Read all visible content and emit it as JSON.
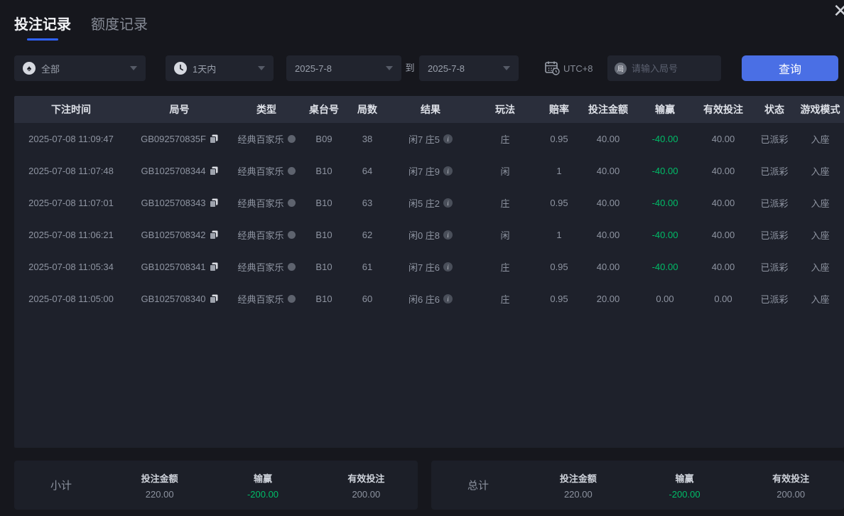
{
  "window": {
    "close_glyph": "✕"
  },
  "tabs": [
    {
      "label": "投注记录",
      "active": true
    },
    {
      "label": "额度记录",
      "active": false
    }
  ],
  "filters": {
    "game_type": {
      "value": "全部",
      "icon": "spade",
      "glyph": "♠"
    },
    "time_range": {
      "value": "1天内",
      "icon": "clock"
    },
    "date_from": "2025-7-8",
    "to_label": "到",
    "date_to": "2025-7-8",
    "timezone": "UTC+8",
    "round_icon_glyph": "局",
    "round_placeholder": "请输入局号",
    "search_label": "查询"
  },
  "table": {
    "headers": [
      "下注时间",
      "局号",
      "类型",
      "桌台号",
      "局数",
      "结果",
      "玩法",
      "赔率",
      "投注金额",
      "输赢",
      "有效投注",
      "状态",
      "游戏模式"
    ],
    "rows": [
      {
        "time": "2025-07-08 11:09:47",
        "round_id": "GB092570835F",
        "type": "经典百家乐",
        "table_no": "B09",
        "round": "38",
        "result": "闲7 庄5",
        "play": "庄",
        "odds": "0.95",
        "bet": "40.00",
        "win": "-40.00",
        "valid": "40.00",
        "status": "已派彩",
        "mode": "入座"
      },
      {
        "time": "2025-07-08 11:07:48",
        "round_id": "GB1025708344",
        "type": "经典百家乐",
        "table_no": "B10",
        "round": "64",
        "result": "闲7 庄9",
        "play": "闲",
        "odds": "1",
        "bet": "40.00",
        "win": "-40.00",
        "valid": "40.00",
        "status": "已派彩",
        "mode": "入座"
      },
      {
        "time": "2025-07-08 11:07:01",
        "round_id": "GB1025708343",
        "type": "经典百家乐",
        "table_no": "B10",
        "round": "63",
        "result": "闲5 庄2",
        "play": "庄",
        "odds": "0.95",
        "bet": "40.00",
        "win": "-40.00",
        "valid": "40.00",
        "status": "已派彩",
        "mode": "入座"
      },
      {
        "time": "2025-07-08 11:06:21",
        "round_id": "GB1025708342",
        "type": "经典百家乐",
        "table_no": "B10",
        "round": "62",
        "result": "闲0 庄8",
        "play": "闲",
        "odds": "1",
        "bet": "40.00",
        "win": "-40.00",
        "valid": "40.00",
        "status": "已派彩",
        "mode": "入座"
      },
      {
        "time": "2025-07-08 11:05:34",
        "round_id": "GB1025708341",
        "type": "经典百家乐",
        "table_no": "B10",
        "round": "61",
        "result": "闲7 庄6",
        "play": "庄",
        "odds": "0.95",
        "bet": "40.00",
        "win": "-40.00",
        "valid": "40.00",
        "status": "已派彩",
        "mode": "入座"
      },
      {
        "time": "2025-07-08 11:05:00",
        "round_id": "GB1025708340",
        "type": "经典百家乐",
        "table_no": "B10",
        "round": "60",
        "result": "闲6 庄6",
        "play": "庄",
        "odds": "0.95",
        "bet": "20.00",
        "win": "0.00",
        "valid": "0.00",
        "status": "已派彩",
        "mode": "入座"
      }
    ]
  },
  "summary": {
    "subtotal": {
      "label": "小计",
      "bet_label": "投注金额",
      "bet": "220.00",
      "win_label": "输赢",
      "win": "-200.00",
      "valid_label": "有效投注",
      "valid": "200.00"
    },
    "total": {
      "label": "总计",
      "bet_label": "投注金额",
      "bet": "220.00",
      "win_label": "输赢",
      "win": "-200.00",
      "valid_label": "有效投注",
      "valid": "200.00"
    }
  },
  "colors": {
    "accent_blue": "#4a6fe5",
    "tab_underline": "#2f62ff",
    "negative_green": "#00bd68"
  }
}
